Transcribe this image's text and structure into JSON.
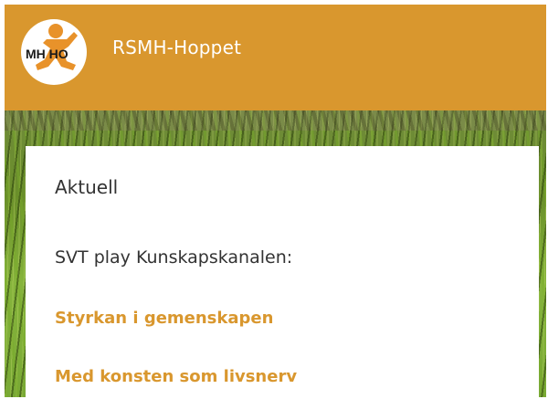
{
  "header": {
    "site_title": "RSMH-Hoppet",
    "logo_text": "MH HO"
  },
  "card": {
    "heading": "Aktuell",
    "subtitle": "SVT play Kunskapskanalen:",
    "links": [
      {
        "label": "Styrkan i gemenskapen"
      },
      {
        "label": "Med konsten som livsnerv"
      }
    ]
  },
  "colors": {
    "accent": "#d9972e",
    "text": "#333333",
    "background": "#ffffff"
  }
}
